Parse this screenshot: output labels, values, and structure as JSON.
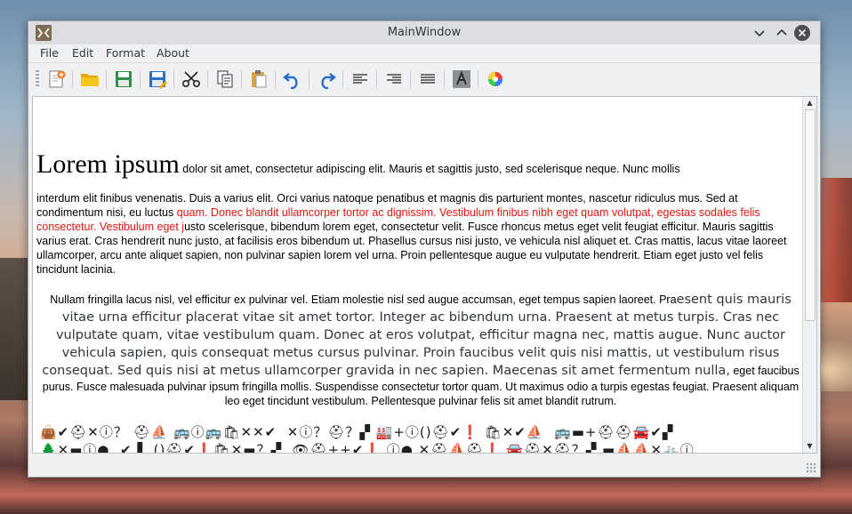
{
  "window": {
    "title": "MainWindow"
  },
  "menu": [
    "File",
    "Edit",
    "Format",
    "About"
  ],
  "toolbar": {
    "tools": [
      "new-document",
      "open-folder",
      "save",
      "save-as",
      "cut",
      "copy",
      "paste",
      "undo",
      "redo",
      "align-left",
      "align-right",
      "justify",
      "text-color",
      "color-wheel"
    ]
  },
  "document": {
    "big_text": "Lorem ipsum",
    "line1": " dolor sit amet, consectetur adipiscing elit. Mauris et sagittis justo, sed scelerisque neque. Nunc mollis",
    "p1_a": "interdum elit finibus venenatis. Duis a varius elit. Orci varius natoque penatibus et magnis dis parturient montes, nascetur ridiculus mus. Sed at condimentum nisi, eu luctus ",
    "p1_red": "quam. Donec blandit ullamcorper tortor ac dignissim. Vestibulum finibus nibh eget quam volutpat, egestas sodales felis consectetur. Vestibulum eget j",
    "p1_b": "usto scelerisque, bibendum lorem eget, consectetur velit. Fusce rhoncus metus eget velit feugiat efficitur. Mauris sagittis varius erat. Cras hendrerit nunc justo, at facilisis eros bibendum ut. Phasellus cursus nisi justo, ve vehicula nisl aliquet et. Cras mattis, lacus vitae laoreet ullamcorper, arcu ante aliquet sapien, non pulvinar sapien lorem vel urna. Proin pellentesque augue eu vulputate hendrerit. Etiam eget justo vel felis tincidunt lacinia.",
    "p2_a": "Nullam fringilla lacus nisl, vel efficitur ex pulvinar vel. Etiam molestie nisl sed augue accumsan, eget tempus sapien laoreet. Pra",
    "p2_dim": "esent quis mauris vitae urna efficitur placerat vitae sit amet tortor. Integer ac bibendum urna. Praesent at metus turpis. Cras nec vulputate quam, vitae vestibulum quam. Donec at eros volutpat, efficitur magna nec, mattis augue. Nunc auctor vehicula sapien, quis consequat metus cursus pulvinar. Proin faucibus velit quis nisi mattis, ut vestibulum risus consequat. Sed quis nisi at metus ullamcorper gravida in nec sapien. Maecenas sit amet fermentum nulla,",
    "p2_b": " eget faucibus purus. Fusce malesuada pulvinar ipsum fringilla mollis. Suspendisse consectetur tortor quam. Ut maximus odio a turpis egestas feugiat. Praesent aliquam leo eget tincidunt vestibulum. Pellentesque pulvinar felis sit amet blandit rutrum.",
    "icons_line1": "👜✔⛑✕ⓘ？ ⛑⛵ 🚌ⓘ🚌🛍✕✕✔  ✕ⓘ？⛑？▞ 🏭+ⓘ()⛑✔❗ 🛍✕✔⛵  🚌▬+⛑⛑🚘✔▞",
    "icons_line2": "🌲✕▬ⓘ●  ✔ ▌ ()⛑✔❗🛍✕▬？▞  👁⛑++✔❗ ⓘ● ✕⛑⛵⛑❗ 🚘⛑✕⛑？▞ ▬⛵⛵✕🚲ⓘ"
  }
}
